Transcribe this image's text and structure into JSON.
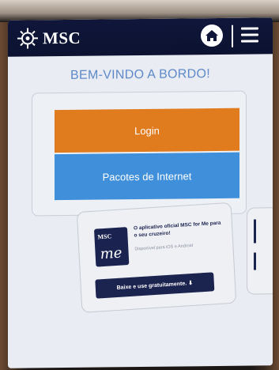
{
  "header": {
    "brand": "MSC",
    "home_icon": "home-icon",
    "menu_icon": "hamburger-menu-icon"
  },
  "welcome": "BEM-VINDO A BORDO!",
  "actions": {
    "login_label": "Login",
    "internet_label": "Pacotes de Internet"
  },
  "app_promo": {
    "logo_top": "MSC",
    "logo_me": "me",
    "title": "O aplicativo oficial MSC for Me para o seu cruzeiro!",
    "subtitle": "Disponível para iOS e Android",
    "download_label": "Baixe e use gratuitamente. ⬇"
  },
  "colors": {
    "navbar": "#10163a",
    "accent_blue": "#5e89c9",
    "login_orange": "#e07b1e",
    "internet_blue": "#3f8fdb",
    "promo_navy": "#1b234f"
  }
}
